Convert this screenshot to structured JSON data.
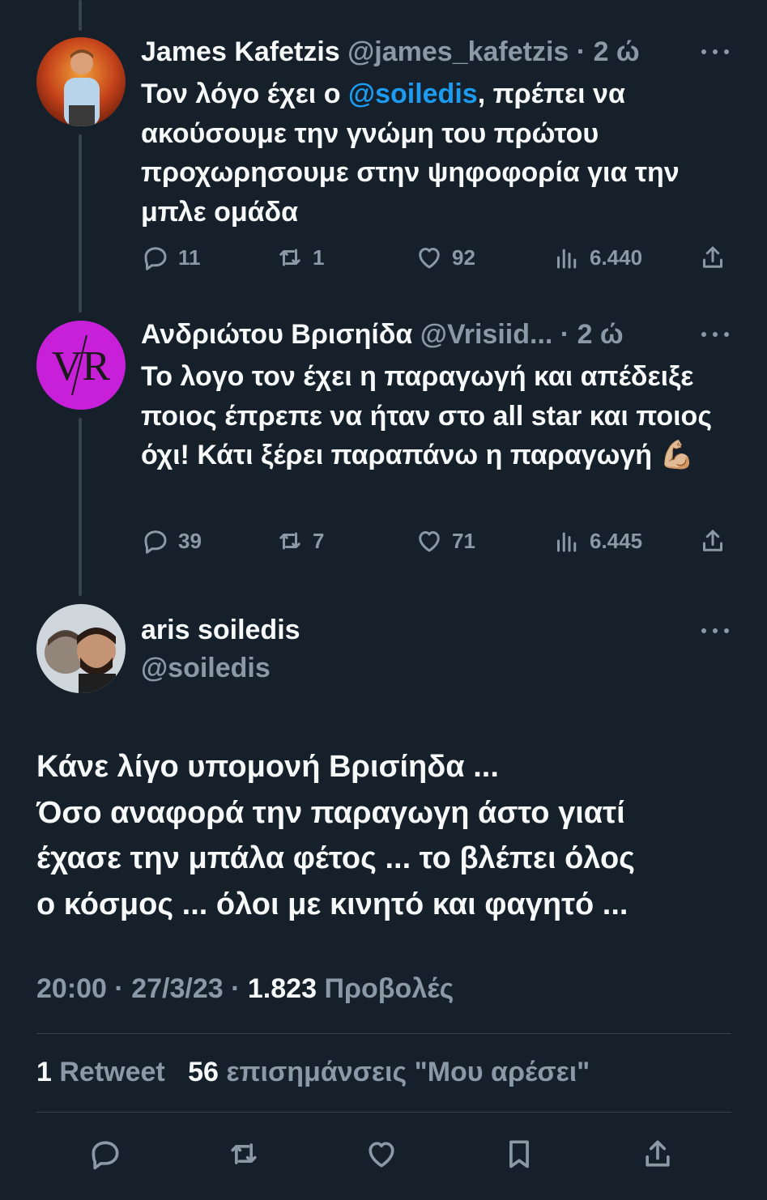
{
  "replies": [
    {
      "name": "James Kafetzis",
      "handle": "@james_kafetzis",
      "sep": "·",
      "time": "2 ώ",
      "text_before": "Τον λόγο έχει ο ",
      "mention": "@soiledis",
      "text_after": ", πρέπει να ακούσουμε την γνώμη του πρώτου προχωρησουμε στην ψηφοφορία για την μπλε ομάδα",
      "replies": "11",
      "retweets": "1",
      "likes": "92",
      "views": "6.440"
    },
    {
      "name": "Ανδριώτου Βρισηίδα",
      "handle": "@Vrisiid...",
      "sep": "·",
      "time": "2 ώ",
      "text": "Το λογο τον έχει η παραγωγή και απέδειξε ποιος έπρεπε να ήταν στο all star και ποιος όχι! Κάτι ξέρει παραπάνω η παραγωγή 💪🏼",
      "avatar_text": "VR",
      "replies": "39",
      "retweets": "7",
      "likes": "71",
      "views": "6.445"
    }
  ],
  "main": {
    "name": "aris soiledis",
    "handle": "@soiledis",
    "lines": [
      "Κάνε λίγο υπομονή Βρισίηδα ...",
      "Όσο αναφορά την παραγωγη άστο γιατί",
      "έχασε την μπάλα φέτος ... το βλέπει όλος",
      "ο κόσμος ... όλοι με κινητό και φαγητό ..."
    ],
    "time": "20:00",
    "sep": "·",
    "date": "27/3/23",
    "views_count": "1.823",
    "views_label": "Προβολές",
    "retweets_count": "1",
    "retweets_label": "Retweet",
    "likes_count": "56",
    "likes_label": "επισημάνσεις \"Μου αρέσει\""
  },
  "colors": {
    "background": "#15202b",
    "text": "#f7f9f9",
    "muted": "#8b98a5",
    "accent": "#1d9bf0",
    "vr_avatar": "#c81fd8"
  },
  "icons": [
    "reply-icon",
    "retweet-icon",
    "like-icon",
    "views-icon",
    "share-icon",
    "bookmark-icon",
    "more-icon"
  ]
}
